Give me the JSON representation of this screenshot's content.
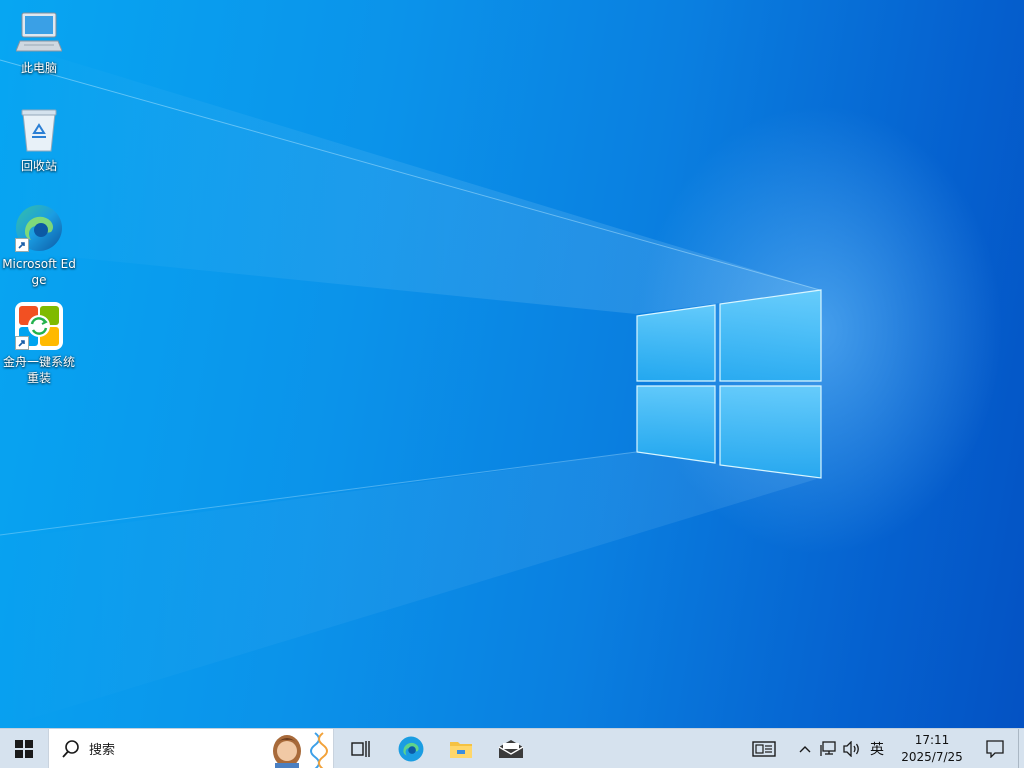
{
  "desktop": {
    "icons": [
      {
        "label": "此电脑",
        "icon": "computer-icon"
      },
      {
        "label": "回收站",
        "icon": "recycle-bin-icon"
      },
      {
        "label": "Microsoft Edge",
        "icon": "edge-icon"
      },
      {
        "label": "金舟一键系统重装",
        "icon": "system-reinstall-icon"
      }
    ]
  },
  "taskbar": {
    "start_icon": "windows-logo-icon",
    "search_placeholder": "搜索",
    "pinned": [
      {
        "name": "task-view",
        "icon": "task-view-icon"
      },
      {
        "name": "edge",
        "icon": "edge-icon"
      },
      {
        "name": "file-explorer",
        "icon": "folder-icon"
      },
      {
        "name": "mail",
        "icon": "mail-icon"
      }
    ],
    "tray": {
      "news_icon": "news-widget-icon",
      "chevron_icon": "chevron-up-icon",
      "network_icon": "network-icon",
      "volume_icon": "volume-icon",
      "language": "英",
      "time": "17:11",
      "date": "2025/7/25",
      "notification_icon": "notification-icon"
    }
  },
  "colors": {
    "wallpaper_light": "#07a6f2",
    "wallpaper_dark": "#0452c3",
    "taskbar": "#d6e2ee"
  }
}
